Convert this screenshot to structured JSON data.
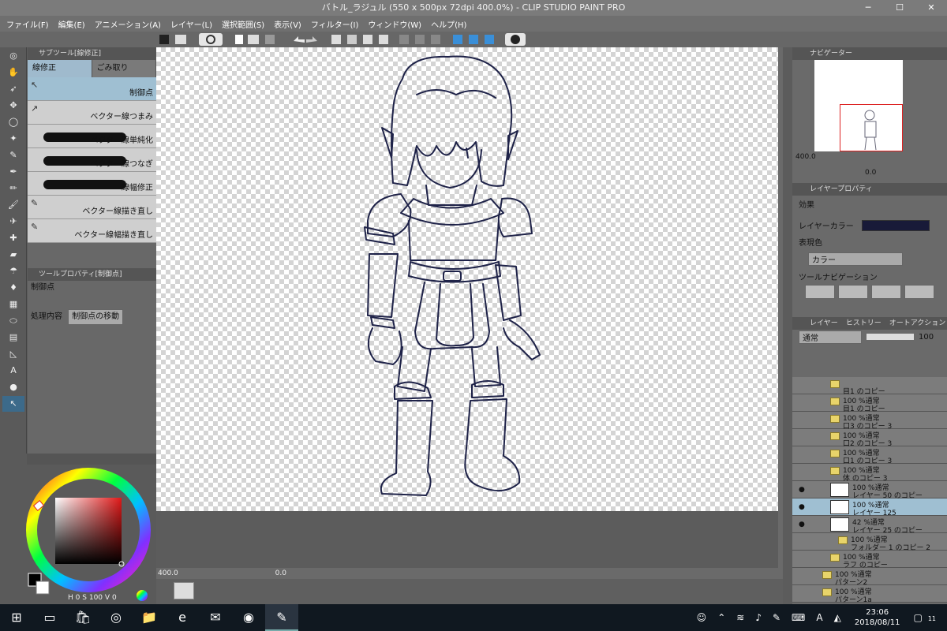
{
  "window": {
    "title": "バトル_ラジュル (550 x 500px 72dpi 400.0%) - CLIP STUDIO PAINT PRO",
    "minimize": "─",
    "maximize": "☐",
    "close": "✕"
  },
  "menu": [
    "ファイル(F)",
    "編集(E)",
    "アニメーション(A)",
    "レイヤー(L)",
    "選択範囲(S)",
    "表示(V)",
    "フィルター(I)",
    "ウィンドウ(W)",
    "ヘルプ(H)"
  ],
  "subtool": {
    "header": "サブツール[線修正]",
    "tabs": [
      "線修正",
      "ごみ取り"
    ],
    "items": [
      "制御点",
      "ベクター線つまみ",
      "ベクター線単純化",
      "ベクター線つなぎ",
      "線幅修正",
      "ベクター線描き直し",
      "ベクター線幅描き直し"
    ]
  },
  "toolprop": {
    "header": "ツールプロパティ[制御点]",
    "tool_name": "制御点",
    "label": "処理内容",
    "value": "制御点の移動"
  },
  "color": {
    "main_hex": "#000000",
    "sub_hex": "#ffffff",
    "readout": "0",
    "readout2": "100",
    "readout3": "0",
    "labels": [
      "H",
      "S",
      "V"
    ]
  },
  "canvas_footer": {
    "zoom": "400.0",
    "angle": "0.0"
  },
  "navigator": {
    "header": "ナビゲーター",
    "zoom": "400.0",
    "angle": "0.0"
  },
  "layer_property": {
    "header": "レイヤープロパティ",
    "effect_label": "効果",
    "layer_color_label": "レイヤーカラー",
    "layer_color_hex": "#181a38",
    "display_color_label": "表現色",
    "display_color_value": "カラー",
    "tool_nav_label": "ツールナビゲーション"
  },
  "layers": {
    "tabs": [
      "レイヤー",
      "ヒストリー",
      "オートアクション"
    ],
    "blend": "通常",
    "opacity": "100",
    "rows": [
      {
        "top": "",
        "name": "目1 のコピー",
        "type": "folder",
        "indent": 1
      },
      {
        "top": "100 %通常",
        "name": "目1 のコピー",
        "type": "folder",
        "indent": 1
      },
      {
        "top": "100 %通常",
        "name": "口3 のコピー 3",
        "type": "folder",
        "indent": 1
      },
      {
        "top": "100 %通常",
        "name": "口2 のコピー 3",
        "type": "folder",
        "indent": 1
      },
      {
        "top": "100 %通常",
        "name": "口1 のコピー 3",
        "type": "folder",
        "indent": 1
      },
      {
        "top": "100 %通常",
        "name": "体 のコピー 3",
        "type": "folder-open",
        "indent": 1
      },
      {
        "top": "100 %通常",
        "name": "レイヤー 50 のコピー",
        "type": "layer",
        "indent": 2
      },
      {
        "top": "100 %通常",
        "name": "レイヤー 125",
        "type": "layer",
        "indent": 2,
        "selected": true
      },
      {
        "top": "42 %通常",
        "name": "レイヤー 25 のコピー",
        "type": "layer",
        "indent": 2
      },
      {
        "top": "100 %通常",
        "name": "フォルダー 1 のコピー 2",
        "type": "folder",
        "indent": 2
      },
      {
        "top": "100 %通常",
        "name": "ラフ のコピー",
        "type": "folder",
        "indent": 1
      },
      {
        "top": "100 %通常",
        "name": "パターン2",
        "type": "folder",
        "indent": 0
      },
      {
        "top": "100 %通常",
        "name": "パターン1a",
        "type": "folder",
        "indent": 0
      }
    ]
  },
  "taskbar": {
    "time": "23:06",
    "date": "2018/08/11",
    "notif": "11",
    "ime": "A"
  }
}
